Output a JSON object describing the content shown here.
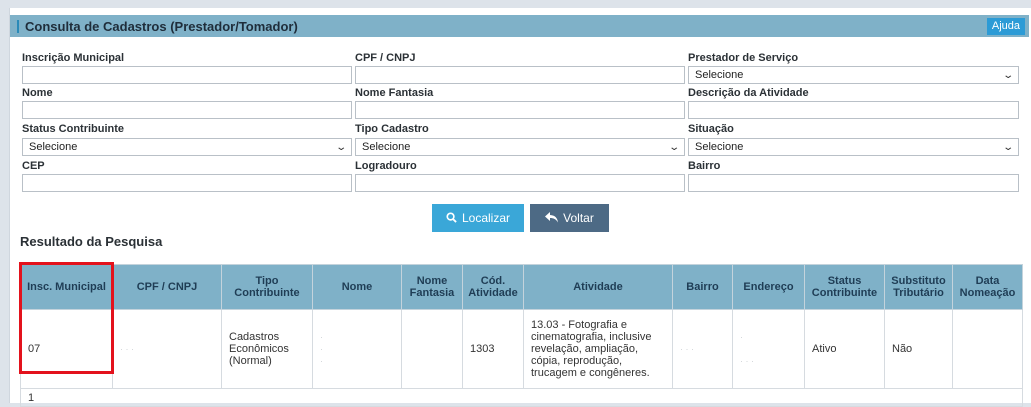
{
  "header": {
    "title": "Consulta de Cadastros (Prestador/Tomador)",
    "help_label": "Ajuda"
  },
  "form": {
    "inscricao_label": "Inscrição Municipal",
    "cpf_label": "CPF / CNPJ",
    "prestador_label": "Prestador de Serviço",
    "prestador_value": "Selecione",
    "nome_label": "Nome",
    "fantasia_label": "Nome Fantasia",
    "descricao_label": "Descrição da Atividade",
    "status_label": "Status Contribuinte",
    "status_value": "Selecione",
    "tipo_label": "Tipo Cadastro",
    "tipo_value": "Selecione",
    "situacao_label": "Situação",
    "situacao_value": "Selecione",
    "cep_label": "CEP",
    "logradouro_label": "Logradouro",
    "bairro_label": "Bairro"
  },
  "buttons": {
    "search_label": "Localizar",
    "back_label": "Voltar"
  },
  "results": {
    "title": "Resultado da Pesquisa",
    "columns": {
      "insc": "Insc. Municipal",
      "cpf": "CPF / CNPJ",
      "tipo": "Tipo Contribuinte",
      "nome": "Nome",
      "fantasia": "Nome Fantasia",
      "cod": "Cód. Atividade",
      "atividade": "Atividade",
      "bairro": "Bairro",
      "endereco": "Endereço",
      "status": "Status Contribuinte",
      "substituto": "Substituto Tributário",
      "data": "Data Nomeação"
    },
    "row": {
      "insc": "07",
      "tipo": "Cadastros Econômicos (Normal)",
      "cod": "1303",
      "atividade": "13.03 - Fotografia e cinematografia, inclusive revelação, ampliação, cópia, reprodução, trucagem e congêneres.",
      "status": "Ativo",
      "substituto": "Não"
    },
    "page": "1"
  },
  "colors": {
    "header_bg": "#7fb1c8",
    "primary_button": "#3aa7d8",
    "secondary_button": "#4d6a85",
    "highlight": "#e3121c"
  }
}
